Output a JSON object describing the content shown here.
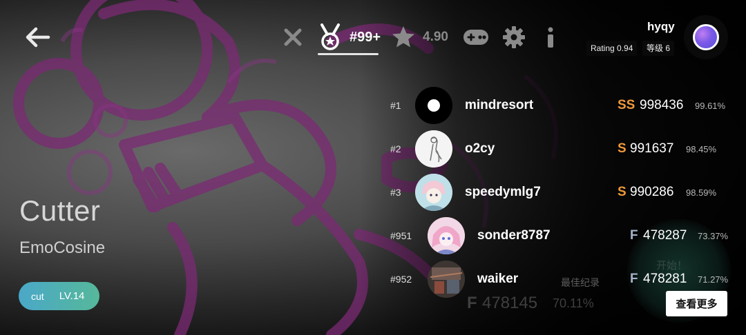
{
  "header": {
    "back_icon": "arrow-left-icon",
    "close_icon": "close-icon",
    "rank_icon": "medal-icon",
    "rank_label": "#99+",
    "rating_icon": "star-icon",
    "rating_value": "4.90",
    "gamepad_icon": "gamepad-icon",
    "settings_icon": "gear-icon",
    "info_icon": "info-icon"
  },
  "user": {
    "name": "hyqy",
    "rating_badge": "Rating 0.94",
    "level_badge": "等级 6"
  },
  "song": {
    "title": "Cutter",
    "artist": "EmoCosine",
    "difficulty_name": "cut",
    "difficulty_level": "LV.14"
  },
  "leaderboard": [
    {
      "rank": "#1",
      "name": "mindresort",
      "grade": "SS",
      "score": "998436",
      "accuracy": "99.61%"
    },
    {
      "rank": "#2",
      "name": "o2cy",
      "grade": "S",
      "score": "991637",
      "accuracy": "98.45%"
    },
    {
      "rank": "#3",
      "name": "speedymlg7",
      "grade": "S",
      "score": "990286",
      "accuracy": "98.59%"
    },
    {
      "rank": "#951",
      "name": "sonder8787",
      "grade": "F",
      "score": "478287",
      "accuracy": "73.37%"
    },
    {
      "rank": "#952",
      "name": "waiker",
      "grade": "F",
      "score": "478281",
      "accuracy": "71.27%"
    }
  ],
  "personal_best": {
    "label": "最佳纪录",
    "grade": "F",
    "score": "478145",
    "accuracy": "70.11%"
  },
  "start_label": "开始！",
  "more_button": "查看更多",
  "colors": {
    "grade_s": "#f0993a",
    "grade_f": "#a7b3c9",
    "diff_pill_start": "#4aa8c8",
    "diff_pill_end": "#56b89a"
  }
}
